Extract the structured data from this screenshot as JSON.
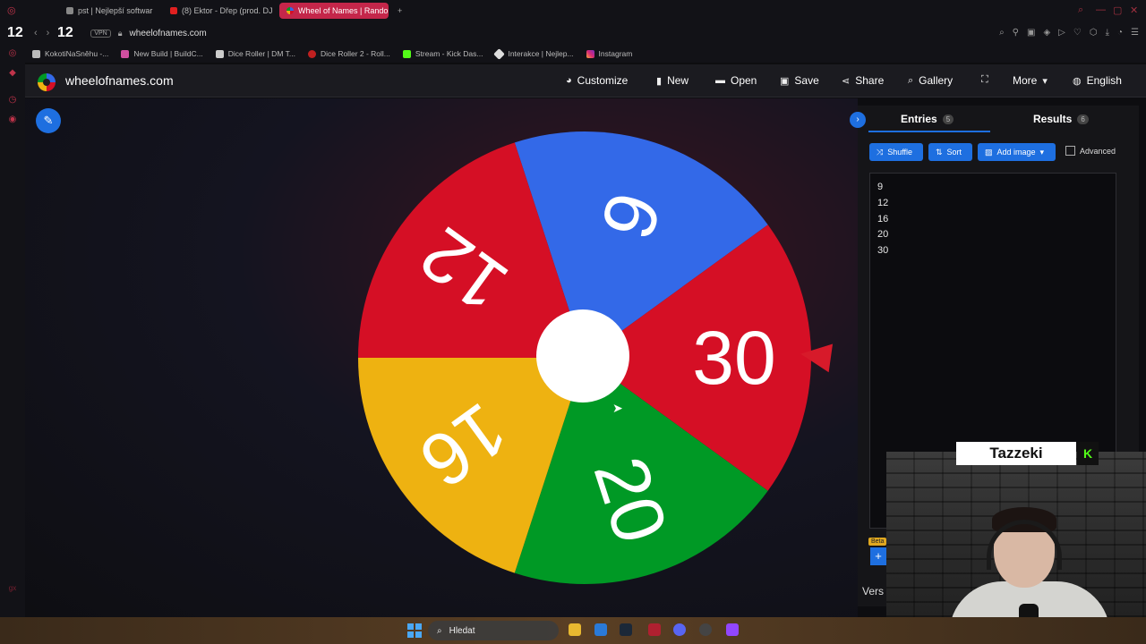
{
  "browser": {
    "tabs": [
      {
        "label": "pst | Nejlepší softwar"
      },
      {
        "label": "(8) Ektor - Dřep (prod. DJ"
      },
      {
        "label": "Wheel of Names | Random"
      }
    ],
    "new_tab": "+",
    "stream_overlay_count": "12",
    "stream_overlay_count2": "12",
    "vpn": "VPN",
    "url": "wheelofnames.com",
    "bookmarks": [
      {
        "label": "KokotiNaSněhu -..."
      },
      {
        "label": "New Build | BuildC..."
      },
      {
        "label": "Dice Roller | DM T..."
      },
      {
        "label": "Dice Roller 2 - Roll..."
      },
      {
        "label": "Stream - Kick Das..."
      },
      {
        "label": "Interakce | Nejlep..."
      },
      {
        "label": "Instagram"
      }
    ]
  },
  "site": {
    "title": "wheelofnames.com",
    "menu": {
      "customize": "Customize",
      "new": "New",
      "open": "Open",
      "save": "Save",
      "share": "Share",
      "gallery": "Gallery",
      "more": "More",
      "language": "English"
    }
  },
  "wheel": {
    "segments": [
      {
        "label": "9",
        "color": "#3369e8"
      },
      {
        "label": "30",
        "color": "#d50f25"
      },
      {
        "label": "20",
        "color": "#009925"
      },
      {
        "label": "16",
        "color": "#eeb211"
      },
      {
        "label": "12",
        "color": "#d50f25"
      }
    ],
    "pointer_color": "#d71a2a"
  },
  "panel": {
    "tabs": {
      "entries_label": "Entries",
      "entries_count": "5",
      "results_label": "Results",
      "results_count": "6"
    },
    "buttons": {
      "shuffle": "Shuffle",
      "sort": "Sort",
      "add_image": "Add image",
      "advanced": "Advanced"
    },
    "entries": [
      "9",
      "12",
      "16",
      "20",
      "30"
    ],
    "beta_tag": "Beta",
    "version": "Vers"
  },
  "webcam": {
    "name": "Tazzeki",
    "badge": "K"
  },
  "taskbar": {
    "search_placeholder": "Hledat"
  },
  "colors": {
    "accent": "#1e6fe0",
    "tab_active": "#c4264a"
  }
}
